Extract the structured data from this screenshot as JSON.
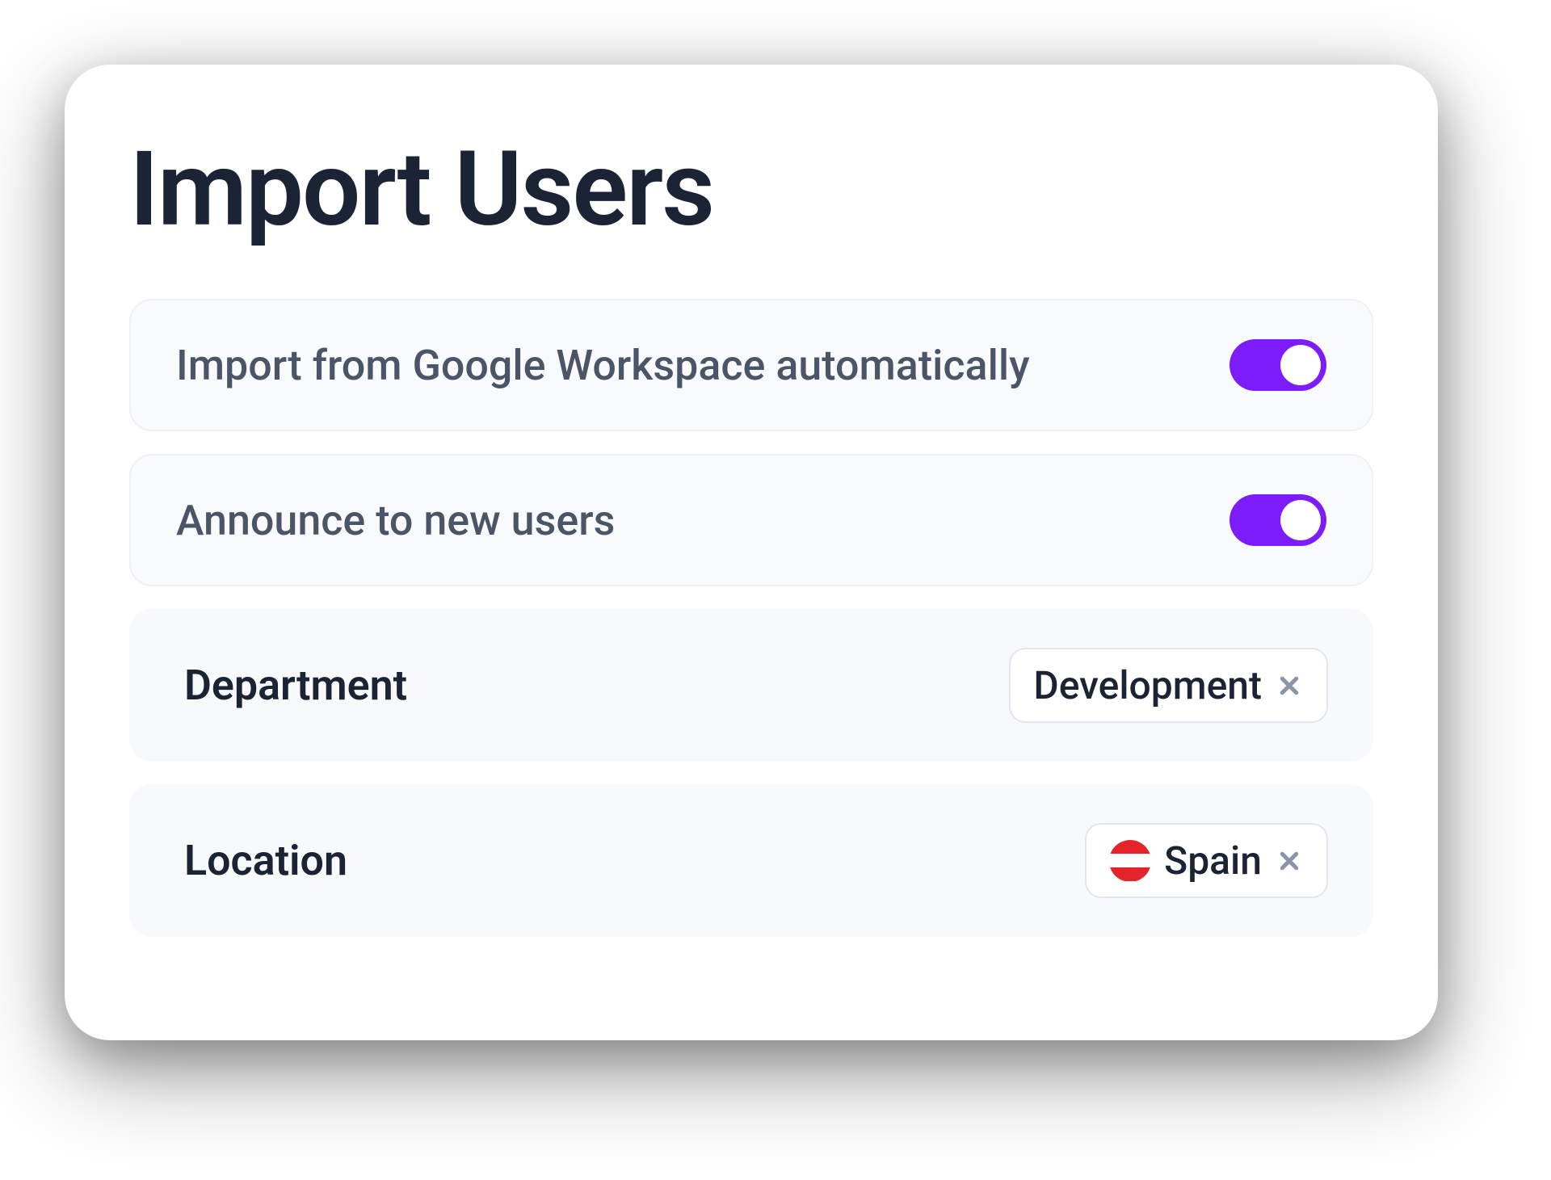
{
  "title": "Import Users",
  "toggles": [
    {
      "label": "Import from Google Workspace automatically",
      "on": true
    },
    {
      "label": "Announce to new users",
      "on": true
    }
  ],
  "filters": {
    "department": {
      "label": "Department",
      "chip": "Development"
    },
    "location": {
      "label": "Location",
      "chip": "Spain"
    }
  },
  "colors": {
    "accent": "#7c1cfb",
    "text_primary": "#1b2434",
    "text_secondary": "#4a5568"
  }
}
